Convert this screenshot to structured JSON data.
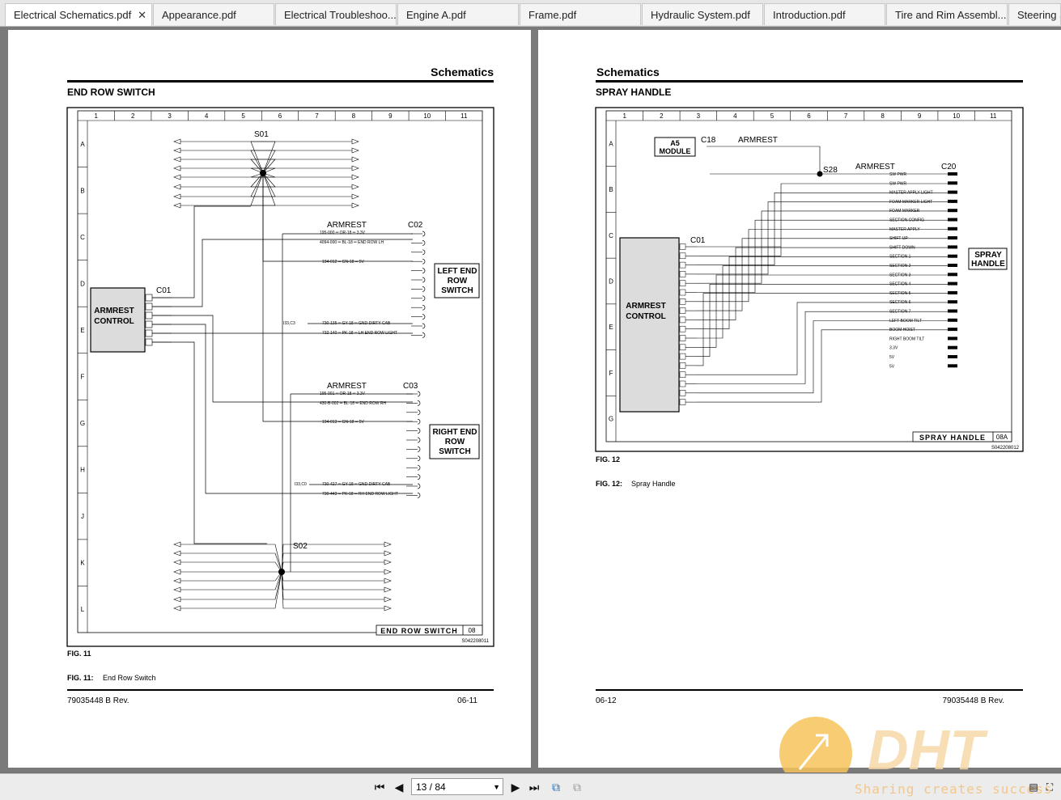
{
  "tabs": [
    {
      "label": "Electrical Schematics.pdf",
      "active": true
    },
    {
      "label": "Appearance.pdf"
    },
    {
      "label": "Electrical Troubleshoo..."
    },
    {
      "label": "Engine A.pdf"
    },
    {
      "label": "Frame.pdf"
    },
    {
      "label": "Hydraulic System.pdf"
    },
    {
      "label": "Introduction.pdf"
    },
    {
      "label": "Tire and Rim Assembl..."
    },
    {
      "label": "Steering S"
    }
  ],
  "left_page": {
    "header": "Schematics",
    "section_title": "END ROW SWITCH",
    "fig_label": "FIG. 11",
    "caption_label": "FIG. 11:",
    "caption_text": "End Row Switch",
    "doc_number": "79035448 B Rev.",
    "page_number": "06-11",
    "diagram": {
      "title_block": "END ROW SWITCH",
      "sheet": "08",
      "drawing_number": "S042208011",
      "main_component": [
        "ARMREST",
        "CONTROL"
      ],
      "main_connector": "C01",
      "splice_top": "S01",
      "splice_bottom": "S02",
      "connector_left": "C02",
      "connector_right": "C03",
      "armrest_label_1": "ARMREST",
      "armrest_label_2": "ARMREST",
      "left_switch": [
        "LEFT END",
        "ROW",
        "SWITCH"
      ],
      "right_switch": [
        "RIGHT END",
        "ROW",
        "SWITCH"
      ],
      "c02_wires": [
        "195-000 ═ OR-18 ═ 3.3V",
        "4094-000 ═ BL-18 ═ END ROW LH",
        "194-012 ═ GN-18 ═ 5V",
        "730-135 ═ GY-18 ═ GND-DIRTY CAB",
        "732-140 ═ PK-18 ═ LH END ROW LIGHT"
      ],
      "c03_wires": [
        "195-001 ═ OR-18 ═ 3.3V",
        "430-B-002 ═ BL-18 ═ END ROW RH",
        "194-013 ═ GN-18 ═ 5V",
        "730-427 ═ GY-18 ═ GND-DIRTY CAB",
        "730-443 ═ PK-18 ═ RH END ROW LIGHT"
      ],
      "c03_refs": [
        "I33,C3",
        "I33,C0"
      ]
    }
  },
  "right_page": {
    "header": "Schematics",
    "section_title": "SPRAY HANDLE",
    "fig_label": "FIG. 12",
    "caption_label": "FIG. 12:",
    "caption_text": "Spray Handle",
    "doc_number": "79035448 B Rev.",
    "page_number": "06-12",
    "diagram": {
      "title_block": "SPRAY HANDLE",
      "sheet": "08A",
      "drawing_number": "S042208012",
      "main_component": [
        "ARMREST",
        "CONTROL"
      ],
      "main_connector": "C01",
      "module": [
        "A5",
        "MODULE"
      ],
      "module_connector": "C18",
      "armrest_label_1": "ARMREST",
      "armrest_label_2": "ARMREST",
      "splice": "S28",
      "handle_connector": "C20",
      "handle": [
        "SPRAY",
        "HANDLE"
      ],
      "wires": [
        "SW PWR",
        "SW PWR",
        "MASTER APPLY LIGHT",
        "FOAM MARKER LIGHT",
        "FOAM MARKER",
        "SECTION CONFIG",
        "MASTER APPLY",
        "SHIFT UP",
        "SHIFT DOWN",
        "SECTION 1",
        "SECTION 2",
        "SECTION 3",
        "SECTION 4",
        "SECTION 5",
        "SECTION 6",
        "SECTION 7",
        "LEFT BOOM TILT",
        "BOOM HOIST",
        "RIGHT BOOM TILT",
        "3.3V",
        "5V",
        "5V"
      ]
    }
  },
  "footer": {
    "page_indicator": "13 / 84"
  },
  "watermark": {
    "logo_text": "DHT",
    "tagline": "Sharing creates success"
  }
}
